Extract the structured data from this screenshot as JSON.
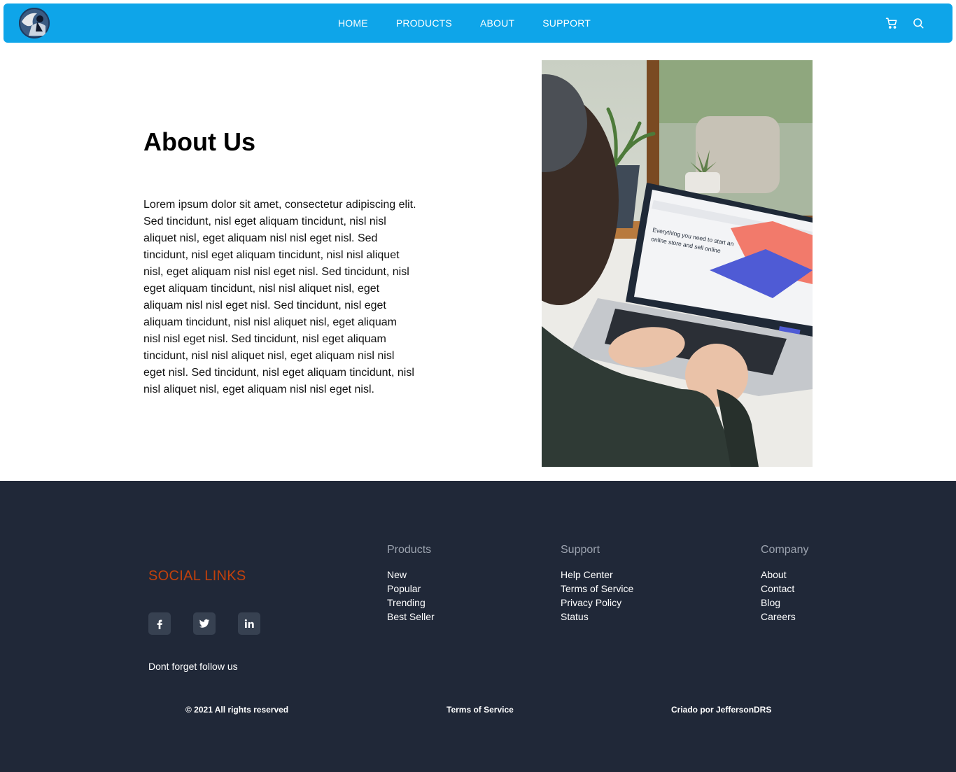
{
  "nav": {
    "links": [
      "HOME",
      "PRODUCTS",
      "ABOUT",
      "SUPPORT"
    ],
    "icons": [
      "cart-icon",
      "search-icon"
    ]
  },
  "about": {
    "title": "About Us",
    "body": "Lorem ipsum dolor sit amet, consectetur adipiscing elit. Sed tincidunt, nisl eget aliquam tincidunt, nisl nisl aliquet nisl, eget aliquam nisl nisl eget nisl. Sed tincidunt, nisl eget aliquam tincidunt, nisl nisl aliquet nisl, eget aliquam nisl nisl eget nisl. Sed tincidunt, nisl eget aliquam tincidunt, nisl nisl aliquet nisl, eget aliquam nisl nisl eget nisl. Sed tincidunt, nisl eget aliquam tincidunt, nisl nisl aliquet nisl, eget aliquam nisl nisl eget nisl. Sed tincidunt, nisl eget aliquam tincidunt, nisl nisl aliquet nisl, eget aliquam nisl nisl eget nisl. Sed tincidunt, nisl eget aliquam tincidunt, nisl nisl aliquet nisl, eget aliquam nisl nisl eget nisl."
  },
  "laptop_screen": {
    "line1": "Everything you need to start an",
    "line2": "online store and sell online"
  },
  "footer": {
    "social_title": "SOCIAL LINKS",
    "social_icons": [
      "facebook-icon",
      "twitter-icon",
      "linkedin-icon"
    ],
    "follow_text": "Dont forget follow us",
    "columns": [
      {
        "title": "Products",
        "items": [
          "New",
          "Popular",
          "Trending",
          "Best Seller"
        ]
      },
      {
        "title": "Support",
        "items": [
          "Help Center",
          "Terms of Service",
          "Privacy Policy",
          "Status"
        ]
      },
      {
        "title": "Company",
        "items": [
          "About",
          "Contact",
          "Blog",
          "Careers"
        ]
      }
    ],
    "copyright": "© 2021 All rights reserved",
    "terms": "Terms of Service",
    "credit": "Criado por JeffersonDRS"
  },
  "colors": {
    "nav_bg": "#0ea5e9",
    "footer_bg": "#202838",
    "social_title": "#c2410c",
    "social_btn_bg": "#374151"
  }
}
